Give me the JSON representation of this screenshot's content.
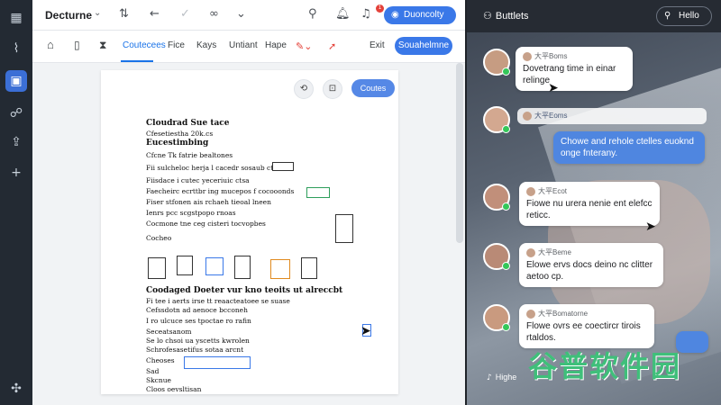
{
  "topbar": {
    "title": "Decturne",
    "cta_label": "Duoncolty",
    "badge_count": "1"
  },
  "toolbar": {
    "tabs": [
      {
        "label": "Coutecees"
      },
      {
        "label": "Fice"
      },
      {
        "label": "Kays"
      },
      {
        "label": "Untiant"
      },
      {
        "label": "Hape"
      }
    ],
    "edit_label": "Exit",
    "share_label": "Souahelmne"
  },
  "doc": {
    "cta_label": "Coutes",
    "lines": {
      "title": "Cloudrad Sue tace",
      "subtitle": "Cfesetiestha 20k.cs",
      "section1": "Eucestimbing",
      "row1": "Cfcne Tk fatrie bealtones",
      "row2": "Fii sulcheloc herja l cacedr sosaub ctin",
      "row3": "Fiisdace i cutec yeceriuic ctsa",
      "row4": "Faecheirc ecrttbr ing mucepos f cocooonds",
      "row5": "Fiser stfonen ais rchaeh tieoal lneen",
      "row6": "Ienrs pcc scgstpopo rnoas",
      "bullet1": "Cocmone tne ceg cisteri tocvopbes",
      "row7": "Cocheo",
      "section2": "Coodaged Doeter vur kno teoits ut alreccbt",
      "row8": "Fi tee i aerts irse tt reaacteatoee se suase",
      "row9": "Cefssdotn ad aenoce bcconeh",
      "bullet2": "I ro ulcuce ses tpoctae ro rafin",
      "row10": "Seceatsanom",
      "row11": "Se lo chsoi ua yscetts kwrolen",
      "row12": "Schrofesasetifus sotaa arcnt",
      "row13": "Cheoses",
      "row14": "Sad",
      "row15": "Skcnue",
      "row16": "Cloos oevsltisan"
    }
  },
  "chat": {
    "title": "Buttlets",
    "button_label": "Hello",
    "messages": [
      {
        "sender": "大平Boms",
        "text": "Dovetrang time in einar relinge"
      },
      {
        "sender": "大平Eoms",
        "text": ""
      },
      {
        "sender": "",
        "text": "Chowe and rehole ctelles euoknd onge fnterany."
      },
      {
        "sender": "大平Ecot",
        "text": "Fiowe nu urera nenie ent elefcc reticc."
      },
      {
        "sender": "大平Beme",
        "text": "Elowe ervs docs deino nc clitter aetoo cp."
      },
      {
        "sender": "大平Bomatorne",
        "text": "Flowe ovrs ee coectircr tirois rtaldos."
      }
    ],
    "footer_label": "Highe"
  },
  "watermark_text": "谷普软件园",
  "colors": {
    "accent": "#3a78e8",
    "rail": "#232a33",
    "chat_header": "#262b33",
    "watermark": "#3fbf7a"
  }
}
